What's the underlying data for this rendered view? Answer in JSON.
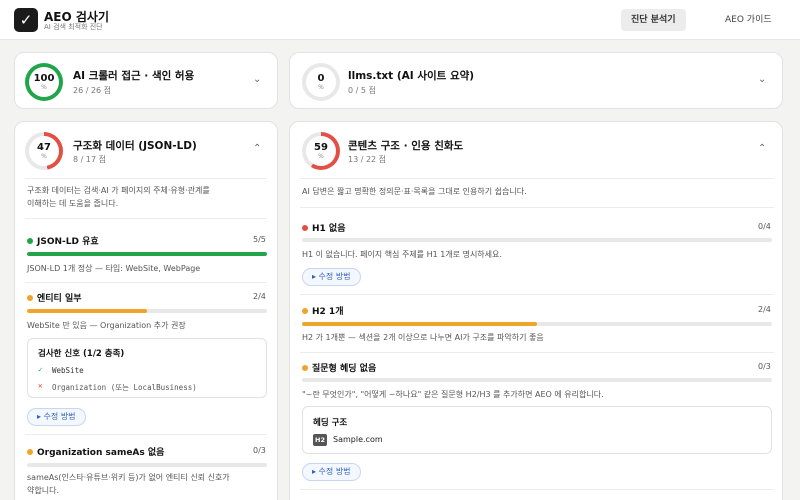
{
  "app": {
    "title": "AEO 검사기",
    "subtitle": "AI 검색 최적화 진단",
    "logo_icon": "checkmark-icon"
  },
  "nav": {
    "active": "진단 분석기",
    "other": "AEO 가이드"
  },
  "colors": {
    "green": "#22a54a",
    "orange": "#f0a42a",
    "red": "#e25045",
    "gray": "#d9d9d9",
    "link": "#2f5fb8"
  },
  "cards": {
    "crawler": {
      "score": "100",
      "pct": "%",
      "title": "AI 크롤러 접근 · 색인 허용",
      "sub": "26 / 26 점"
    },
    "llms": {
      "score": "0",
      "pct": "%",
      "title": "llms.txt (AI 사이트 요약)",
      "sub": "0 / 5 점"
    },
    "structured": {
      "score": "47",
      "pct": "%",
      "title": "구조화 데이터 (JSON-LD)",
      "sub": "8 / 17 점",
      "desc1": "구조화 데이터는 검색·AI 가 페이지의 주체·유형·관계를",
      "desc2": "이해하는 데 도움을 줍니다.",
      "items": [
        {
          "title": "JSON-LD 유효",
          "score": "5/5",
          "desc": "JSON-LD 1개 정상 — 타입: WebSite, WebPage",
          "fill": 1.0
        },
        {
          "title": "엔티티 일부",
          "score": "2/4",
          "desc": "WebSite 만 있음 — Organization 추가 권장",
          "fill": 0.5
        },
        {
          "title": "Organization sameAs 없음",
          "score": "0/3",
          "desc1": "sameAs(인스타·유튜브·위키 등)가 없어 엔티티 신뢰 신호가",
          "desc2": "약합니다.",
          "fill": 0
        }
      ],
      "signals": {
        "title": "검사한 신호 (1/2 충족)",
        "ok": "WebSite",
        "missing": "Organization (또는 LocalBusiness)"
      },
      "fix_label": "▸ 수정 방법"
    },
    "content": {
      "score": "59",
      "pct": "%",
      "title": "콘텐츠 구조 · 인용 친화도",
      "sub": "13 / 22 점",
      "desc": "AI 답변은 짧고 명확한 정의문·표·목록을 그대로 인용하기 쉽습니다.",
      "items": [
        {
          "title": "H1 없음",
          "score": "0/4",
          "desc": "H1 이 없습니다. 페이지 핵심 주제를 H1 1개로 명시하세요.",
          "fill": 0
        },
        {
          "title": "H2 1개",
          "score": "2/4",
          "desc": "H2 가 1개뿐 — 섹션을 2개 이상으로 나누면 AI가 구조를 파악하기 좋음",
          "fill": 0.5
        },
        {
          "title": "질문형 헤딩 없음",
          "score": "0/3",
          "desc": "\"~란 무엇인가\", \"어떻게 ~하나요\" 같은 질문형 H2/H3 를 추가하면 AEO 에 유리합니다.",
          "fill": 0
        }
      ],
      "heading": {
        "title": "헤딩 구조",
        "tag": "H2",
        "text": "Sample.com"
      },
      "fix_label": "▸ 수정 방법"
    }
  }
}
